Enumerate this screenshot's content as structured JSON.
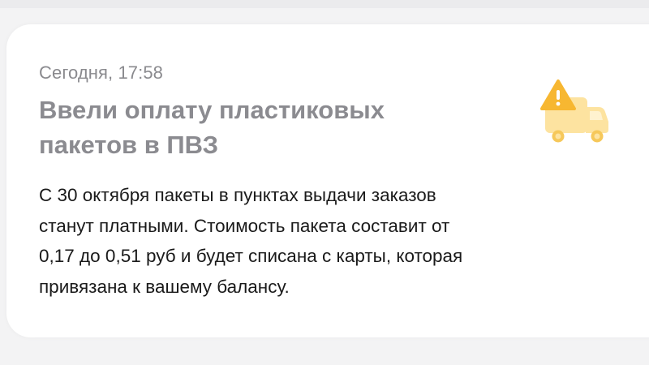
{
  "notification": {
    "timestamp": "Сегодня, 17:58",
    "title_line1": "Ввели оплату пластиковых",
    "title_line2": "пакетов в ПВЗ",
    "body_line1": "С 30 октября пакеты в пунктах выдачи заказов",
    "body_line2": "станут платными. Стоимость пакета составит от",
    "body_line3": "0,17 до 0,51 руб и будет списана с карты, которая",
    "body_line4": "привязана к вашему балансу.",
    "icon": "warning-truck-icon"
  },
  "colors": {
    "background": "#f3f3f4",
    "card": "#ffffff",
    "title": "#8b8b90",
    "timestamp": "#8a8a8e",
    "body": "#1a1a1a",
    "icon_truck": "#fde3a0",
    "icon_warning": "#f7b731"
  }
}
